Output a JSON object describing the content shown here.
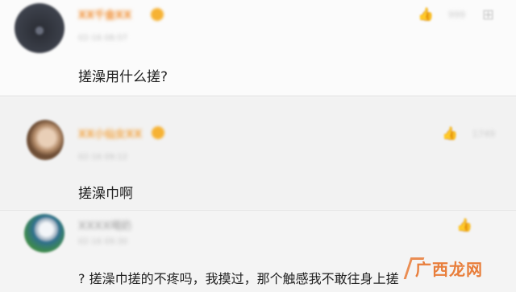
{
  "comments": [
    {
      "username": "XX千金XX",
      "time": "02-16 08:57",
      "likes": "999",
      "text": "搓澡用什么搓?"
    },
    {
      "username": "XX小仙女XX",
      "time": "02-16 09:12",
      "likes": "1749",
      "text": "搓澡巾啊"
    },
    {
      "username": "XXXX喝奶",
      "time": "02-16 09:30",
      "likes": "",
      "text": "? 搓澡巾搓的不疼吗，我摸过，那个触感我不敢往身上搓"
    }
  ],
  "icons": {
    "like": "thumbs-up-icon",
    "more": "more-options-icon"
  },
  "watermark": "广西龙网",
  "colors": {
    "username_vip": "#f08a2a",
    "badge": "#f6b233",
    "watermark": "#e8742c"
  }
}
